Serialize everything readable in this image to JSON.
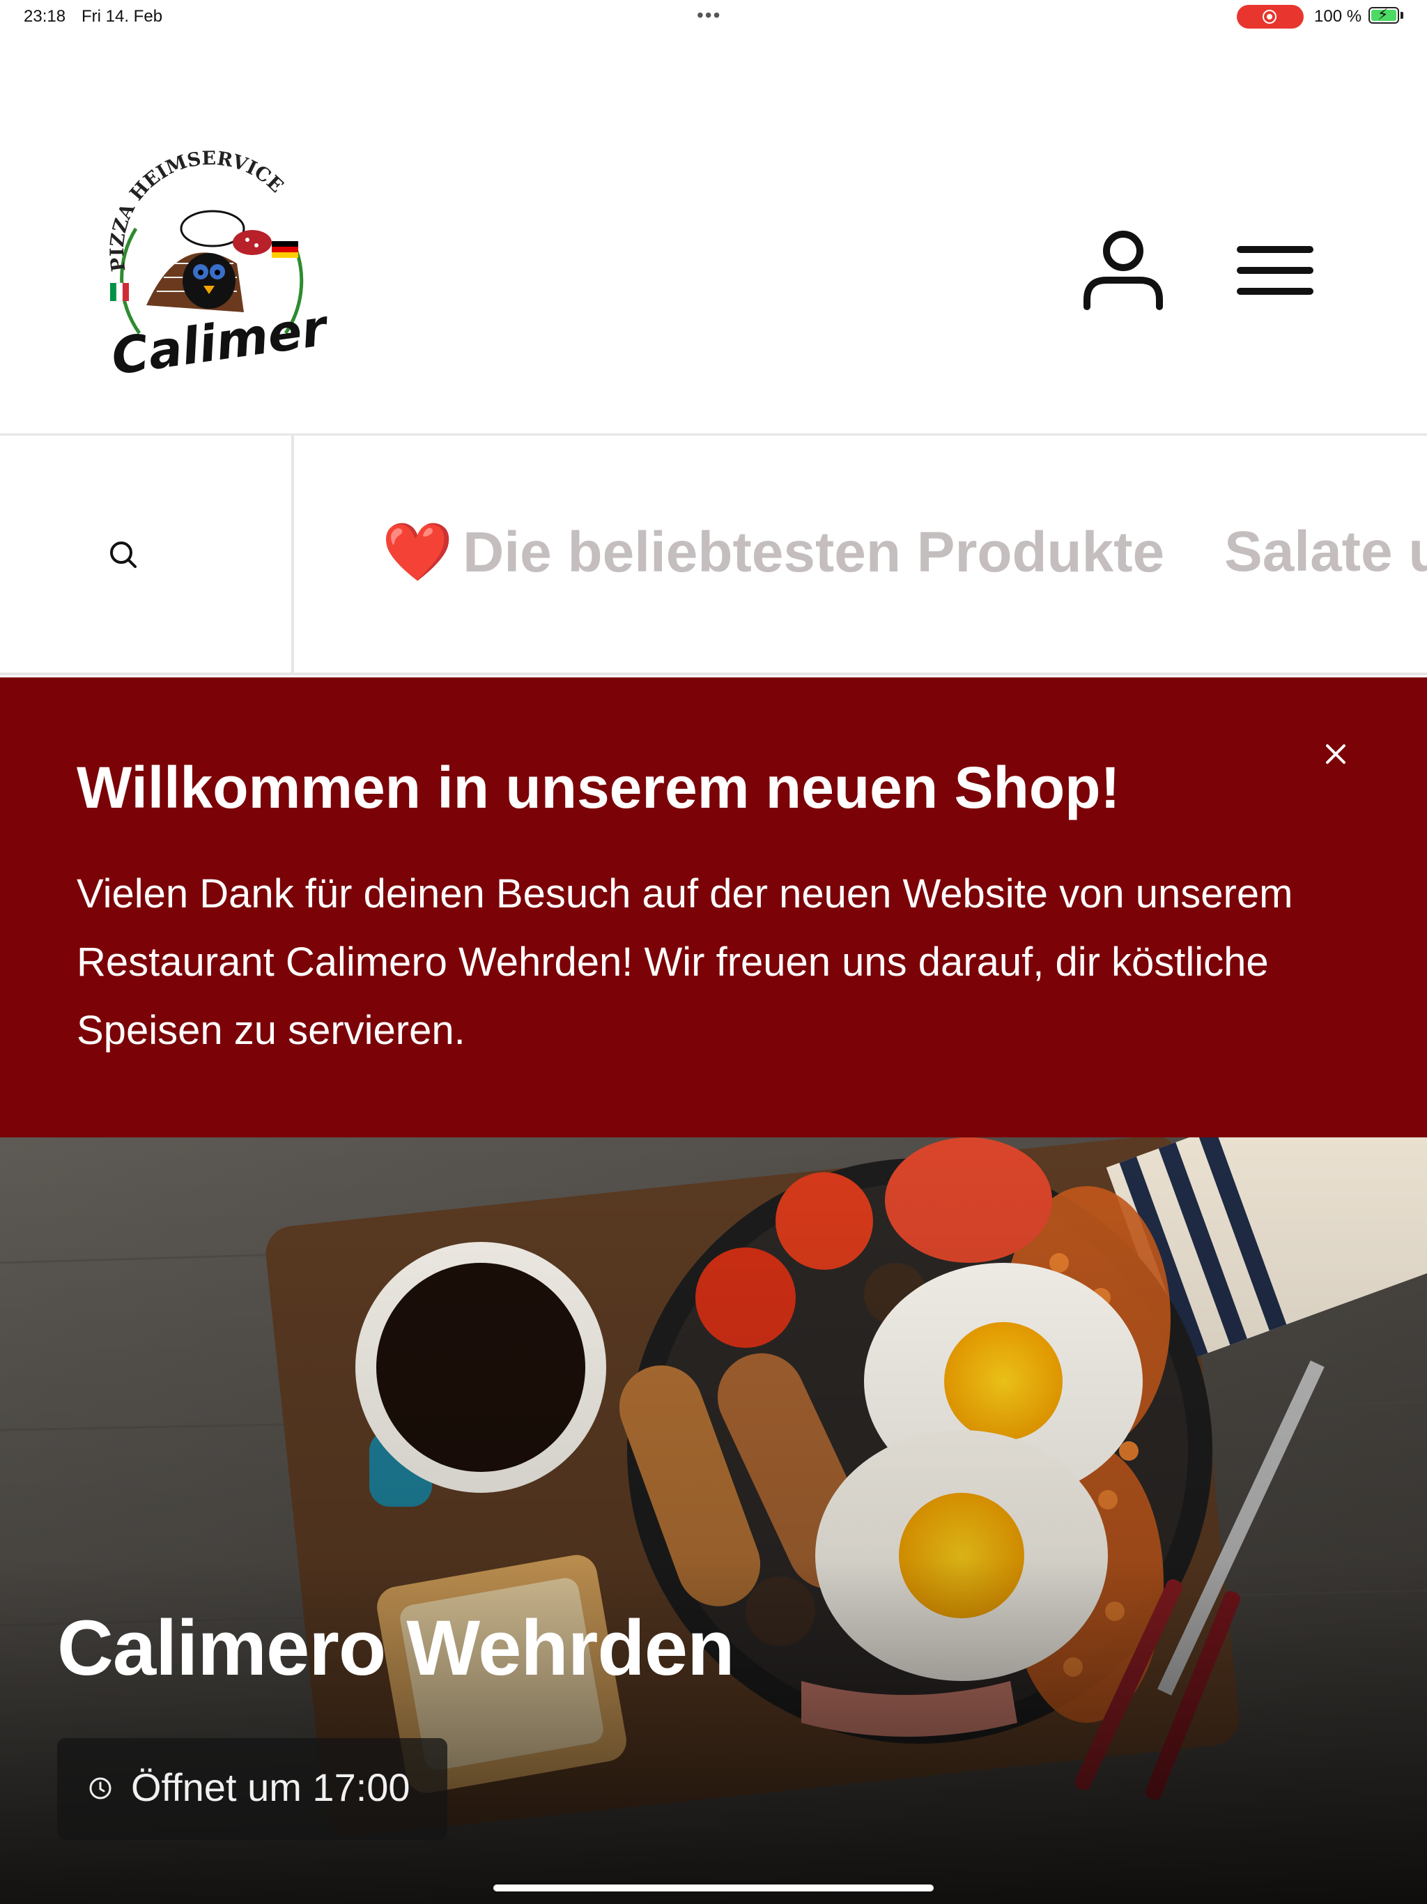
{
  "status_bar": {
    "time": "23:18",
    "date": "Fri 14. Feb",
    "battery": "100 %"
  },
  "header": {
    "logo": {
      "arc_text": "PIZZA HEIMSERVICE",
      "brand": "Calimero"
    },
    "user_icon": "user-icon",
    "menu_icon": "hamburger-menu-icon"
  },
  "nav": {
    "search_icon": "search-icon",
    "categories": [
      {
        "emoji": "❤️",
        "label": "Die beliebtesten Produkte"
      },
      {
        "label": "Salate u"
      }
    ]
  },
  "banner": {
    "title": "Willkommen in unserem neuen Shop!",
    "text": "Vielen Dank für deinen Besuch auf der neuen Website von unserem Restaurant Calimero Wehrden! Wir freuen uns darauf, dir köstliche Speisen zu servieren.",
    "close_icon": "close-icon",
    "color": "#7b0307"
  },
  "hero": {
    "title": "Calimero Wehrden",
    "opening": "Öffnet um 17:00",
    "clock_icon": "clock-icon"
  }
}
